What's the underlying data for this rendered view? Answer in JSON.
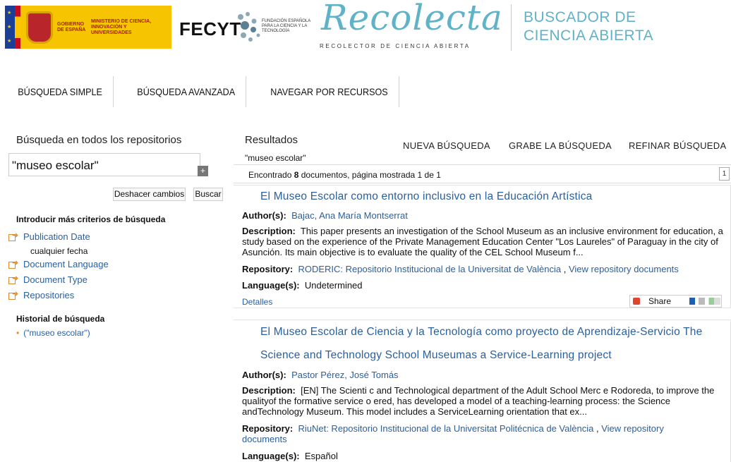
{
  "header": {
    "gov_line1": "GOBIERNO DE ESPAÑA",
    "gov_line2": "MINISTERIO DE CIENCIA, INNOVACIÓN Y UNIVERSIDADES",
    "fecyt": "FECYT",
    "fecyt_sub": "FUNDACIÓN ESPAÑOLA PARA LA CIENCIA Y LA TECNOLOGÍA",
    "recolecta": "Recolecta",
    "recolecta_sub": "RECOLECTOR DE CIENCIA ABIERTA",
    "buscador_line1": "BUSCADOR DE",
    "buscador_line2": "CIENCIA ABIERTA"
  },
  "nav": [
    "BÚSQUEDA SIMPLE",
    "BÚSQUEDA AVANZADA",
    "NAVEGAR POR RECURSOS"
  ],
  "sidebar": {
    "title": "Búsqueda en todos los repositorios",
    "search_value": "\"museo escolar\"",
    "plus": "+",
    "undo_label": "Deshacer cambios",
    "search_label": "Buscar",
    "more_criteria": "Introducir más criterios de búsqueda",
    "facets": [
      "Publication Date",
      "Document Language",
      "Document Type",
      "Repositories"
    ],
    "date_sub": "cualquier fecha",
    "history_title": "Historial de búsqueda",
    "history_item": "(\"museo escolar\")"
  },
  "results": {
    "title": "Resultados",
    "actions": [
      "NUEVA BÚSQUEDA",
      "GRABE LA BÚSQUEDA",
      "REFINAR BÚSQUEDA"
    ],
    "query": "\"museo escolar\"",
    "found_prefix": "Encontrado ",
    "found_count": "8",
    "found_suffix": " documentos, página mostrada 1 de 1",
    "page": "1",
    "items": [
      {
        "title": "El Museo Escolar como entorno inclusivo en la Educación Artística",
        "author_label": "Author(s):",
        "author": "Bajac, Ana María Montserrat",
        "desc_label": "Description:",
        "description": "This paper presents an investigation of the School Museum as an inclusive environment for education, a study based on the experience of the Private Management Education Center \"Los Laureles\" of Paraguay in the city of Asunción. Its main objective is to evaluate the quality of the CEL School Museum f...",
        "repo_label": "Repository:",
        "repository": "RODERIC: Repositorio Institucional de la Universitat de València",
        "repo_sep": ",",
        "view_docs": "View repository documents",
        "lang_label": "Language(s):",
        "language": "Undetermined",
        "details": "Detalles",
        "share": "Share"
      },
      {
        "title_line1": "El Museo Escolar de Ciencia y la Tecnología como proyecto de Aprendizaje-Servicio The",
        "title_line2": "Science and Technology School Museumas a Service-Learning project",
        "author_label": "Author(s):",
        "author": "Pastor Pérez, José Tomás",
        "desc_label": "Description:",
        "description": "[EN] The Scienti c and Technological department of the Adult School Merc e Rodoreda, to improve the qualityof the formative service o ered, has developed a model of a teaching-learning process: the Science andTechnology Museum. This model includes a ServiceLearning orientation that ex...",
        "repo_label": "Repository:",
        "repository": "RiuNet: Repositorio Institucional de la Universitat Politécnica de València",
        "repo_sep": ",",
        "view_docs_line1": "View repository",
        "view_docs_line2": "documents",
        "lang_label": "Language(s):",
        "language": "Español"
      }
    ]
  }
}
